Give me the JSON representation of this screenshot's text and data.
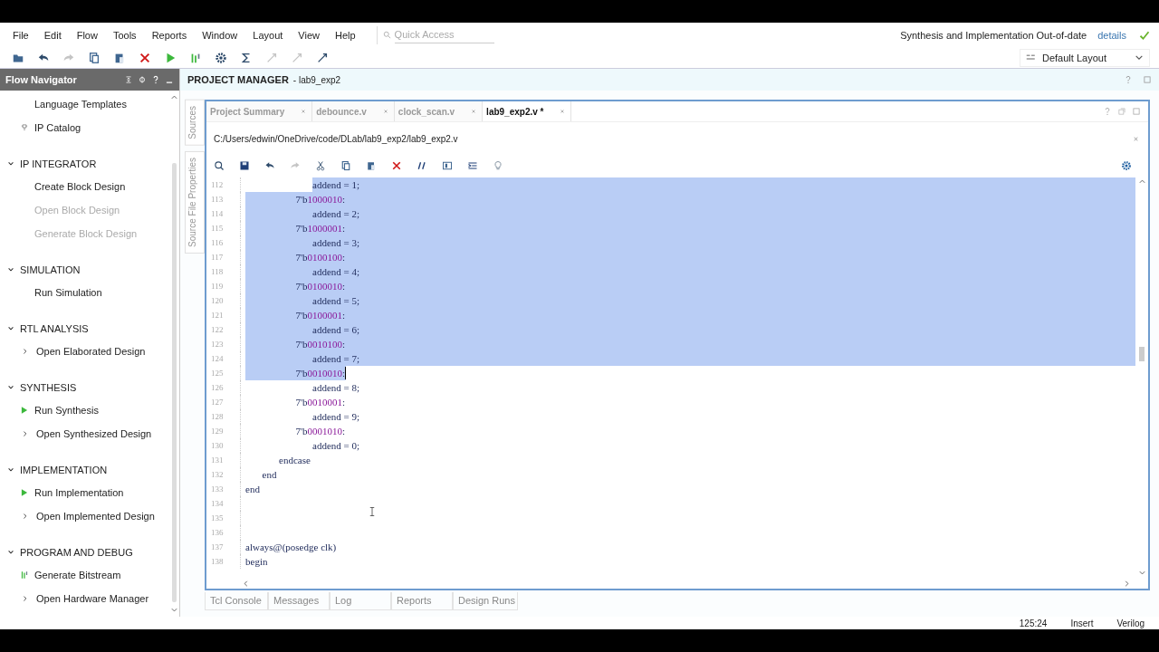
{
  "menu": [
    "File",
    "Edit",
    "Flow",
    "Tools",
    "Reports",
    "Window",
    "Layout",
    "View",
    "Help"
  ],
  "quick_access": {
    "placeholder": "Quick Access"
  },
  "status_message": {
    "text": "Synthesis and Implementation Out-of-date",
    "link": "details"
  },
  "toolbar": [
    {
      "kind": "open",
      "disabled": false
    },
    {
      "kind": "undo",
      "disabled": false
    },
    {
      "kind": "redo",
      "disabled": true
    },
    {
      "kind": "copy",
      "disabled": false
    },
    {
      "kind": "paste",
      "disabled": false
    },
    {
      "kind": "delete",
      "disabled": false
    },
    {
      "kind": "run",
      "disabled": false
    },
    {
      "kind": "bitstream",
      "disabled": false
    },
    {
      "kind": "settings",
      "disabled": false
    },
    {
      "kind": "sigma",
      "disabled": false
    },
    {
      "kind": "tool",
      "disabled": true
    },
    {
      "kind": "tool",
      "disabled": true
    },
    {
      "kind": "tool",
      "disabled": false
    }
  ],
  "layout_select": {
    "value": "Default Layout"
  },
  "flow_navigator": {
    "title": "Flow Navigator",
    "top_items": [
      {
        "label": "Language Templates",
        "kind": "plain",
        "disabled": false
      },
      {
        "label": "IP Catalog",
        "kind": "ip",
        "disabled": false
      }
    ],
    "sections": [
      {
        "title": "IP INTEGRATOR",
        "expanded": true,
        "items": [
          {
            "label": "Create Block Design",
            "kind": "plain",
            "disabled": false
          },
          {
            "label": "Open Block Design",
            "kind": "plain",
            "disabled": true
          },
          {
            "label": "Generate Block Design",
            "kind": "plain",
            "disabled": true
          }
        ]
      },
      {
        "title": "SIMULATION",
        "expanded": true,
        "items": [
          {
            "label": "Run Simulation",
            "kind": "plain",
            "disabled": false
          }
        ]
      },
      {
        "title": "RTL ANALYSIS",
        "expanded": true,
        "items": [
          {
            "label": "Open Elaborated Design",
            "kind": "expand",
            "disabled": false
          }
        ]
      },
      {
        "title": "SYNTHESIS",
        "expanded": true,
        "items": [
          {
            "label": "Run Synthesis",
            "kind": "run",
            "disabled": false
          },
          {
            "label": "Open Synthesized Design",
            "kind": "expand",
            "disabled": false
          }
        ]
      },
      {
        "title": "IMPLEMENTATION",
        "expanded": true,
        "items": [
          {
            "label": "Run Implementation",
            "kind": "run",
            "disabled": false
          },
          {
            "label": "Open Implemented Design",
            "kind": "expand",
            "disabled": false
          }
        ]
      },
      {
        "title": "PROGRAM AND DEBUG",
        "expanded": true,
        "items": [
          {
            "label": "Generate Bitstream",
            "kind": "bitstream",
            "disabled": false
          },
          {
            "label": "Open Hardware Manager",
            "kind": "expand",
            "disabled": false
          }
        ]
      }
    ]
  },
  "panel": {
    "title": "PROJECT MANAGER",
    "subtitle": "- lab9_exp2"
  },
  "side_tabs": [
    "Sources",
    "Source File Properties"
  ],
  "editor_tabs": [
    {
      "label": "Project Summary",
      "selected": false
    },
    {
      "label": "debounce.v",
      "selected": false
    },
    {
      "label": "clock_scan.v",
      "selected": false
    },
    {
      "label": "lab9_exp2.v *",
      "selected": true
    }
  ],
  "file_path": "C:/Users/edwin/OneDrive/code/DLab/lab9_exp2/lab9_exp2.v",
  "editor_toolbar": [
    {
      "kind": "search",
      "disabled": false
    },
    {
      "kind": "save",
      "disabled": false
    },
    {
      "kind": "undo",
      "disabled": false
    },
    {
      "kind": "redo",
      "disabled": true
    },
    {
      "kind": "cut",
      "disabled": false
    },
    {
      "kind": "copy",
      "disabled": false
    },
    {
      "kind": "paste",
      "disabled": false
    },
    {
      "kind": "delete",
      "disabled": false
    },
    {
      "kind": "comment",
      "disabled": false
    },
    {
      "kind": "columns",
      "disabled": false
    },
    {
      "kind": "indent",
      "disabled": false
    },
    {
      "kind": "bulb",
      "disabled": false
    }
  ],
  "code": [
    {
      "number": "112",
      "selected": true,
      "caret": false,
      "segments": [
        {
          "text": "\t\t\t\taddend = 1;",
          "kind": "plain"
        }
      ]
    },
    {
      "number": "113",
      "selected": true,
      "caret": false,
      "segments": [
        {
          "text": "\t\t\t7'b",
          "kind": "plain"
        },
        {
          "text": "1000010",
          "kind": "number"
        },
        {
          "text": ":",
          "kind": "plain"
        }
      ]
    },
    {
      "number": "114",
      "selected": true,
      "caret": false,
      "segments": [
        {
          "text": "\t\t\t\taddend = 2;",
          "kind": "plain"
        }
      ]
    },
    {
      "number": "115",
      "selected": true,
      "caret": false,
      "segments": [
        {
          "text": "\t\t\t7'b",
          "kind": "plain"
        },
        {
          "text": "1000001",
          "kind": "number"
        },
        {
          "text": ":",
          "kind": "plain"
        }
      ]
    },
    {
      "number": "116",
      "selected": true,
      "caret": false,
      "segments": [
        {
          "text": "\t\t\t\taddend = 3;",
          "kind": "plain"
        }
      ]
    },
    {
      "number": "117",
      "selected": true,
      "caret": false,
      "segments": [
        {
          "text": "\t\t\t7'b",
          "kind": "plain"
        },
        {
          "text": "0100100",
          "kind": "number"
        },
        {
          "text": ":",
          "kind": "plain"
        }
      ]
    },
    {
      "number": "118",
      "selected": true,
      "caret": false,
      "segments": [
        {
          "text": "\t\t\t\taddend = 4;",
          "kind": "plain"
        }
      ]
    },
    {
      "number": "119",
      "selected": true,
      "caret": false,
      "segments": [
        {
          "text": "\t\t\t7'b",
          "kind": "plain"
        },
        {
          "text": "0100010",
          "kind": "number"
        },
        {
          "text": ":",
          "kind": "plain"
        }
      ]
    },
    {
      "number": "120",
      "selected": true,
      "caret": false,
      "segments": [
        {
          "text": "\t\t\t\taddend = 5;",
          "kind": "plain"
        }
      ]
    },
    {
      "number": "121",
      "selected": true,
      "caret": false,
      "segments": [
        {
          "text": "\t\t\t7'b",
          "kind": "plain"
        },
        {
          "text": "0100001",
          "kind": "number"
        },
        {
          "text": ":",
          "kind": "plain"
        }
      ]
    },
    {
      "number": "122",
      "selected": true,
      "caret": false,
      "segments": [
        {
          "text": "\t\t\t\taddend = 6;",
          "kind": "plain"
        }
      ]
    },
    {
      "number": "123",
      "selected": true,
      "caret": false,
      "segments": [
        {
          "text": "\t\t\t7'b",
          "kind": "plain"
        },
        {
          "text": "0010100",
          "kind": "number"
        },
        {
          "text": ":",
          "kind": "plain"
        }
      ]
    },
    {
      "number": "124",
      "selected": true,
      "caret": false,
      "segments": [
        {
          "text": "\t\t\t\taddend = 7;",
          "kind": "plain"
        }
      ]
    },
    {
      "number": "125",
      "selected": true,
      "caret": true,
      "segments": [
        {
          "text": "\t\t\t7'b",
          "kind": "plain"
        },
        {
          "text": "0010010",
          "kind": "number"
        },
        {
          "text": ":",
          "kind": "plain"
        }
      ]
    },
    {
      "number": "126",
      "selected": false,
      "caret": false,
      "segments": [
        {
          "text": "\t\t\t\taddend = 8;",
          "kind": "plain"
        }
      ]
    },
    {
      "number": "127",
      "selected": false,
      "caret": false,
      "segments": [
        {
          "text": "\t\t\t7'b",
          "kind": "plain"
        },
        {
          "text": "0010001",
          "kind": "number"
        },
        {
          "text": ":",
          "kind": "plain"
        }
      ]
    },
    {
      "number": "128",
      "selected": false,
      "caret": false,
      "segments": [
        {
          "text": "\t\t\t\taddend = 9;",
          "kind": "plain"
        }
      ]
    },
    {
      "number": "129",
      "selected": false,
      "caret": false,
      "segments": [
        {
          "text": "\t\t\t7'b",
          "kind": "plain"
        },
        {
          "text": "0001010",
          "kind": "number"
        },
        {
          "text": ":",
          "kind": "plain"
        }
      ]
    },
    {
      "number": "130",
      "selected": false,
      "caret": false,
      "segments": [
        {
          "text": "\t\t\t\taddend = 0;",
          "kind": "plain"
        }
      ]
    },
    {
      "number": "131",
      "selected": false,
      "caret": false,
      "segments": [
        {
          "text": "\t\tendcase",
          "kind": "plain"
        }
      ]
    },
    {
      "number": "132",
      "selected": false,
      "caret": false,
      "segments": [
        {
          "text": "\tend",
          "kind": "plain"
        }
      ]
    },
    {
      "number": "133",
      "selected": false,
      "caret": false,
      "segments": [
        {
          "text": "end",
          "kind": "plain"
        }
      ]
    },
    {
      "number": "134",
      "selected": false,
      "caret": false
    },
    {
      "number": "135",
      "selected": false,
      "caret": false
    },
    {
      "number": "136",
      "selected": false,
      "caret": false
    },
    {
      "number": "137",
      "selected": false,
      "caret": false,
      "segments": [
        {
          "text": "always@(posedge clk)",
          "kind": "plain"
        }
      ]
    },
    {
      "number": "138",
      "selected": false,
      "caret": false,
      "segments": [
        {
          "text": "begin",
          "kind": "plain"
        }
      ]
    }
  ],
  "bottom_tabs": [
    {
      "label": "Tcl Console",
      "selected": false
    },
    {
      "label": "Messages",
      "selected": false
    },
    {
      "label": "Log",
      "selected": false
    },
    {
      "label": "Reports",
      "selected": false
    },
    {
      "label": "Design Runs",
      "selected": false
    }
  ],
  "status_bar": {
    "position": "125:24",
    "mode": "Insert",
    "language": "Verilog"
  }
}
